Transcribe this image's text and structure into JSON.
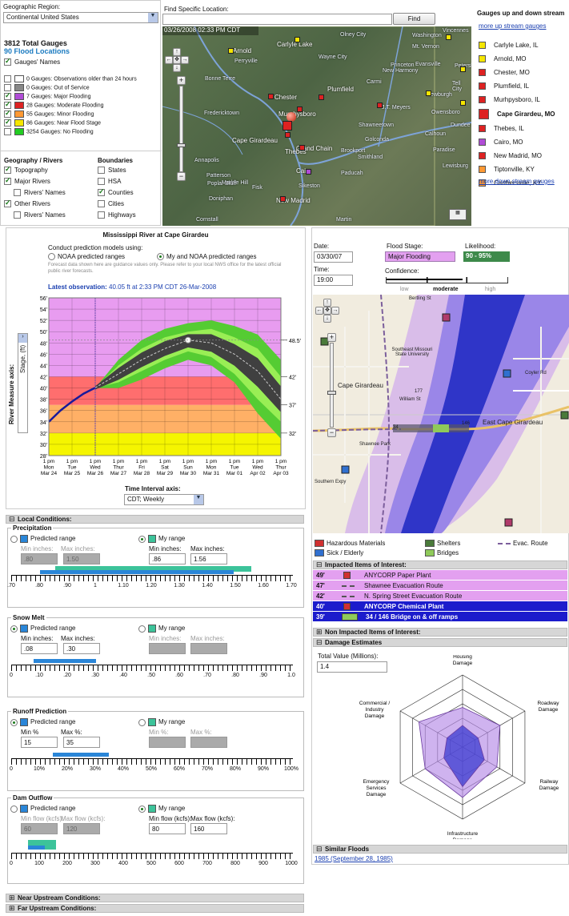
{
  "header": {
    "region_label": "Geographic Region:",
    "region_value": "Continental United States",
    "find_label": "Find Specific Location:",
    "find_value": "",
    "find_button": "Find",
    "total_gauges": "3812 Total Gauges",
    "flood_locations": "90 Flood Locations",
    "gauges_names": "Gauges' Names",
    "legend": [
      {
        "label": "0 Gauges: Observations older than 24 hours",
        "color": "#ffffff",
        "checked": false
      },
      {
        "label": "0 Gauges: Out of Service",
        "color": "#888888",
        "checked": false
      },
      {
        "label": "7 Gauges: Major Flooding",
        "color": "#b04cd6",
        "checked": true
      },
      {
        "label": "28 Gauges: Moderate Flooding",
        "color": "#dd2222",
        "checked": true
      },
      {
        "label": "55 Gauges: Minor Flooding",
        "color": "#ff9933",
        "checked": true
      },
      {
        "label": "86 Gauges: Near Flood Stage",
        "color": "#f5e600",
        "checked": true
      },
      {
        "label": "3254 Gauges: No Flooding",
        "color": "#22cc22",
        "checked": false
      }
    ],
    "geo_title": "Geography / Rivers",
    "geo": [
      {
        "label": "Topography",
        "checked": true
      },
      {
        "label": "Major Rivers",
        "checked": true
      },
      {
        "label": "Rivers' Names",
        "checked": false
      },
      {
        "label": "Other Rivers",
        "checked": true
      },
      {
        "label": "Rivers' Names",
        "checked": false
      }
    ],
    "bound_title": "Boundaries",
    "bound": [
      {
        "label": "States",
        "checked": false
      },
      {
        "label": "HSA",
        "checked": false
      },
      {
        "label": "Counties",
        "checked": true
      },
      {
        "label": "Cities",
        "checked": false
      },
      {
        "label": "Highways",
        "checked": false
      }
    ],
    "map_time": "03/26/2008 02:33 PM CDT",
    "map_labels": [
      "Carlyle Lake",
      "Arnold",
      "Wayne City",
      "Chester",
      "Plumfield",
      "Murphysboro",
      "Cape Girardeau",
      "Thebes",
      "Grand Chain",
      "Brookport",
      "Cairo",
      "Paducah",
      "New Madrid",
      "Golconda",
      "Smithland",
      "Shawneetown",
      "Mt. Vernon",
      "Evansville",
      "Princeton",
      "New Harmony",
      "Carmi",
      "J.T. Meyers",
      "Owensboro",
      "Newburgh",
      "Olney City",
      "Dundee",
      "Calhoun",
      "Paradise",
      "Lewisburg",
      "Sikeston",
      "Perryville",
      "Bonne Terre",
      "Fredericktown",
      "Marble Hill",
      "Patterson",
      "Poplar Bluff",
      "Doniphan",
      "Fisk",
      "Annapolis",
      "Cornstall",
      "Martin",
      "Washington",
      "Petersburg",
      "Vincennes",
      "Tell City"
    ]
  },
  "gauges_panel": {
    "title": "Gauges up and down stream",
    "more_up": "more up stream gauges",
    "more_down": "more down stream gauges",
    "items": [
      {
        "name": "Carlyle Lake, IL",
        "color": "#f5e600"
      },
      {
        "name": "Arnold, MO",
        "color": "#f5e600"
      },
      {
        "name": "Chester, MO",
        "color": "#dd2222"
      },
      {
        "name": "Plumfield, IL",
        "color": "#dd2222"
      },
      {
        "name": "Murhpysboro, IL",
        "color": "#dd2222"
      },
      {
        "name": "Cape Girardeu, MO",
        "color": "#dd2222"
      },
      {
        "name": "Thebes, IL",
        "color": "#dd2222"
      },
      {
        "name": "Cairo, MO",
        "color": "#b04cd6"
      },
      {
        "name": "New Madrid, MO",
        "color": "#dd2222"
      },
      {
        "name": "Tiptonville, KY",
        "color": "#ff9933"
      },
      {
        "name": "Carthersville, KY",
        "color": "#ff9933"
      }
    ]
  },
  "forecast": {
    "title": "Mississippi River at Cape Girardeu",
    "conduct": "Conduct prediction models using:",
    "opt1": "NOAA predicted ranges",
    "opt2": "My and NOAA predicted ranges",
    "disclaimer": "Forecast data shown here are guidance values only.  Please refer to your local NWS office for the latest official public river forecasts.",
    "latest_label": "Latest observation:",
    "latest_value": "40.05 ft at 2:33 PM CDT 26-Mar-2008",
    "axis_label": "River Measure axis:",
    "axis_value": "Stage, (ft)",
    "time_axis_label": "Time Interval axis:",
    "time_axis_value": "CDT; Weekly"
  },
  "chart_data": {
    "type": "line",
    "ylim": [
      28,
      56
    ],
    "y_ticks": [
      "56'",
      "54'",
      "52'",
      "50'",
      "48'",
      "46'",
      "44'",
      "42'",
      "40'",
      "38'",
      "36'",
      "34'",
      "32'",
      "30'",
      "28'"
    ],
    "right_labels": [
      "48.5'",
      "42'",
      "37'",
      "32'"
    ],
    "x_ticks": [
      [
        "1 pm",
        "Mon",
        "Mar 24"
      ],
      [
        "1 pm",
        "Tue",
        "Mar 25"
      ],
      [
        "1 pm",
        "Wed",
        "Mar 26"
      ],
      [
        "1 pm",
        "Thur",
        "Mar 27"
      ],
      [
        "1 pm",
        "Fri",
        "Mar 28"
      ],
      [
        "1 pm",
        "Sat",
        "Mar 29"
      ],
      [
        "1 pm",
        "Sun",
        "Mar 30"
      ],
      [
        "1 pm",
        "Mon",
        "Mar 31"
      ],
      [
        "1 pm",
        "Tue",
        "Mar 01"
      ],
      [
        "1 pm",
        "Wed",
        "Apr 02"
      ],
      [
        "1 pm",
        "Thur",
        "Apr 03"
      ]
    ],
    "bands": [
      {
        "from": 28,
        "to": 32,
        "color": "#f5f500"
      },
      {
        "from": 32,
        "to": 37,
        "color": "#ffb066"
      },
      {
        "from": 37,
        "to": 42,
        "color": "#ff6e6e"
      },
      {
        "from": 42,
        "to": 56,
        "color": "#e89cf0"
      }
    ],
    "observed": {
      "x": [
        0,
        0.5,
        1,
        1.5,
        2
      ],
      "y": [
        34,
        36,
        37.6,
        39,
        40.05
      ]
    },
    "forecast_mid": {
      "x": [
        2,
        3,
        4,
        5,
        6,
        7,
        8,
        9,
        10
      ],
      "y": [
        40.05,
        42.5,
        45,
        47,
        48.5,
        48,
        46,
        43,
        38
      ]
    },
    "forecast_inner": {
      "x": [
        2,
        3,
        4,
        5,
        6,
        7,
        8,
        9,
        10
      ],
      "low": [
        40,
        41,
        43,
        45,
        46.5,
        45.5,
        42.5,
        38,
        34
      ],
      "high": [
        40,
        44,
        47,
        49,
        50,
        50.5,
        49,
        47,
        42
      ]
    },
    "forecast_outer": {
      "x": [
        2,
        3,
        4,
        5,
        6,
        7,
        8,
        9,
        10
      ],
      "low": [
        40,
        40,
        41.5,
        43.5,
        45,
        44,
        41,
        35.5,
        31
      ],
      "high": [
        40,
        45,
        48.5,
        50.5,
        51.5,
        52,
        51,
        49.5,
        45
      ]
    }
  },
  "conditions": {
    "local": "Local Conditions:",
    "precip": {
      "title": "Precipitation",
      "pred": "Predicted range",
      "my": "My range",
      "min_l": "Min inches:",
      "max_l": "Max inches:",
      "pmin": ".80",
      "pmax": "1.50",
      "mmin": ".86",
      "mmax": "1.56",
      "ticks": [
        ".70",
        ".80",
        ".90",
        "1",
        "1.10",
        "1.20",
        "1.30",
        "1.40",
        "1.50",
        "1.60",
        "1.70"
      ]
    },
    "snow": {
      "title": "Snow Melt",
      "pred": "Predicted range",
      "my": "My range",
      "min_l": "Min inches:",
      "max_l": "Max inches:",
      "pmin": ".08",
      "pmax": ".30",
      "mmin": "",
      "mmax": "",
      "ticks": [
        "0",
        ".10",
        ".20",
        ".30",
        ".40",
        ".50",
        ".60",
        ".70",
        ".80",
        ".90",
        "1.0"
      ]
    },
    "runoff": {
      "title": "Runoff Prediction",
      "pred": "Predicted range",
      "my": "My range",
      "min_l": "Min %",
      "max_l": "Max %:",
      "min_l2": "Min %:",
      "max_l2": "Max %:",
      "pmin": "15",
      "pmax": "35",
      "mmin": "",
      "mmax": "",
      "ticks": [
        "0",
        "10%",
        "20%",
        "30%",
        "40%",
        "50%",
        "60%",
        "70%",
        "80%",
        "90%",
        "100%"
      ]
    },
    "dam": {
      "title": "Dam Outflow",
      "pred": "Predicted range",
      "my": "My range",
      "min_l": "Min flow (kcfs):",
      "max_l": "Max flow (kcfs):",
      "pmin": "60",
      "pmax": "120",
      "mmin": "80",
      "mmax": "160",
      "ticks": [
        "0",
        "100",
        "200",
        "300",
        "400",
        "500",
        "600",
        "700",
        "800",
        "900",
        "1000"
      ]
    },
    "near": "Near Upstream Conditions:",
    "far": "Far Upstream Conditions:"
  },
  "impact": {
    "date_label": "Date:",
    "date": "03/30/07",
    "time_label": "Time:",
    "time": "19:00",
    "stage_label": "Flood Stage:",
    "stage": "Major Flooding",
    "like_label": "Likelihood:",
    "like": "90 - 95%",
    "conf_label": "Confidence:",
    "conf_low": "low",
    "conf_mid": "moderate",
    "conf_high": "high",
    "map_labels": [
      "Cape Girardeau",
      "East Cape Girardeau",
      "Southeast Missouri State University",
      "Shawnee Park",
      "Southern Expy",
      "William St",
      "Coyler Rd",
      "Bertling St",
      "177",
      "146",
      "34"
    ],
    "legend": [
      "Hazardous Materials",
      "Shelters",
      "Evac. Route",
      "Sick / Elderly",
      "Bridges"
    ],
    "impacted_title": "Impacted Items of Interest:",
    "impacted": [
      {
        "level": "49'",
        "name": "ANYCORP Paper Plant",
        "bg": "#e3a0f0",
        "fg": "#111",
        "icon": "hazard"
      },
      {
        "level": "47'",
        "name": "Shawnee Evacuation Route",
        "bg": "#e3a0f0",
        "fg": "#111",
        "icon": "route"
      },
      {
        "level": "42'",
        "name": "N. Spring Street Evacuation Route",
        "bg": "#e3a0f0",
        "fg": "#111",
        "icon": "route"
      },
      {
        "level": "40'",
        "name": "ANYCORP Chemical Plant",
        "bg": "#1c1ccc",
        "fg": "#fff",
        "icon": "hazard"
      },
      {
        "level": "39'",
        "name": "34 / 146 Bridge on & off ramps",
        "bg": "#1c1ccc",
        "fg": "#fff",
        "icon": "bridge"
      }
    ],
    "non_impacted": "Non Impacted Items of Interest:",
    "damage_title": "Damage Estimates",
    "total_label": "Total Value (Millions):",
    "total_value": "1.4",
    "radar_labels": [
      "Housing Damage",
      "Roadway Damage",
      "Railway Damage",
      "Infrastructure Damage",
      "Emergency Services Damage",
      "Commercial / Industry Damage"
    ],
    "radar_outer": [
      0.55,
      0.6,
      0.55,
      0.7,
      0.6,
      0.7
    ],
    "radar_inner": [
      0.3,
      0.25,
      0.35,
      0.55,
      0.3,
      0.25
    ],
    "similar_title": "Similar Floods",
    "similar_link": "1985 (September 28, 1985)"
  }
}
